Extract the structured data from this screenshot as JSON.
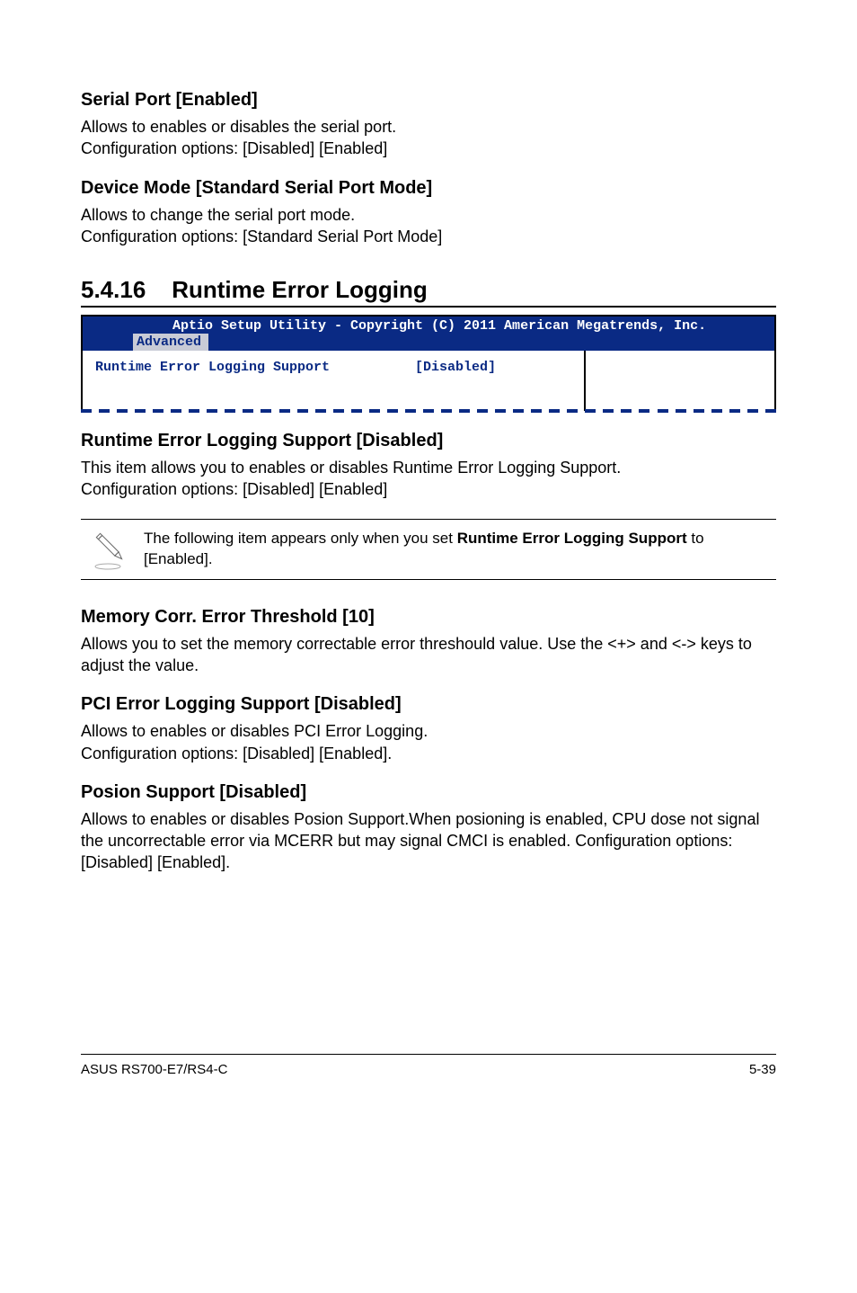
{
  "h1": {
    "title": "Serial Port [Enabled]",
    "line1": "Allows to enables or disables the serial port.",
    "line2": "Configuration options: [Disabled] [Enabled]"
  },
  "h2": {
    "title": "Device Mode [Standard Serial Port Mode]",
    "line1": "Allows to change the serial port mode.",
    "line2": "Configuration options: [Standard Serial Port Mode]"
  },
  "section": {
    "number": "5.4.16",
    "title": "Runtime Error Logging"
  },
  "bios": {
    "copyright": "Aptio Setup Utility - Copyright (C) 2011 American Megatrends, Inc.",
    "tab": "Advanced",
    "setting_label": "Runtime Error Logging Support",
    "setting_value": "[Disabled]"
  },
  "h3": {
    "title": "Runtime Error Logging Support [Disabled]",
    "line1": "This item allows you to enables or disables Runtime Error Logging Support.",
    "line2": "Configuration options: [Disabled] [Enabled]"
  },
  "note": {
    "prefix": "The following item appears only when you set ",
    "bold": "Runtime Error Logging Support",
    "suffix": " to [Enabled]."
  },
  "h4": {
    "title": "Memory Corr. Error Threshold [10]",
    "body": "Allows you to set the memory correctable error threshould value. Use the <+> and <-> keys to adjust the value."
  },
  "h5": {
    "title": "PCI Error Logging Support [Disabled]",
    "line1": "Allows to enables or disables PCI Error Logging.",
    "line2": "Configuration options: [Disabled] [Enabled]."
  },
  "h6": {
    "title": "Posion Support [Disabled]",
    "body": "Allows to enables or disables Posion Support.When posioning is enabled, CPU dose not signal the uncorrectable error via MCERR but may signal CMCI is enabled. Configuration options: [Disabled] [Enabled]."
  },
  "footer": {
    "left": "ASUS RS700-E7/RS4-C",
    "right": "5-39"
  }
}
